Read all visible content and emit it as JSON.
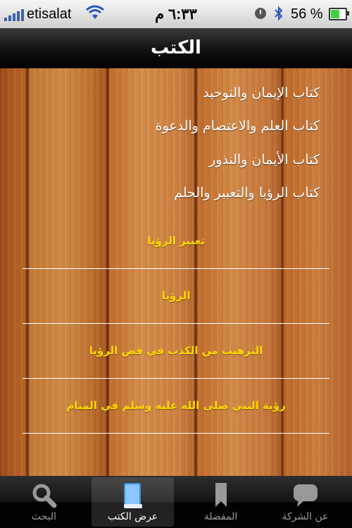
{
  "status_bar": {
    "carrier": "etisalat",
    "time": "٦:٣٣ م",
    "battery_percent": "56 %",
    "battery_level": 0.56
  },
  "nav": {
    "title": "الكتب"
  },
  "books": [
    "كتاب الإيمان والتوحيد",
    "كتاب العلم والاعتصام والدعوة",
    "كتاب الأيمان والنذور",
    "كتاب الرؤيا والتعبير والحلم"
  ],
  "sections": [
    "تعبير الرؤيا",
    "الرؤيا",
    "الترهيب من الكذب في قص الرؤيا",
    "رؤية النبي صلى الله عليه وسلم في المنام"
  ],
  "tabs": [
    {
      "label": "البحث",
      "icon": "search-icon"
    },
    {
      "label": "عرض الكتب",
      "icon": "book-icon"
    },
    {
      "label": "المفضلة",
      "icon": "bookmark-icon"
    },
    {
      "label": "عن الشركة",
      "icon": "speech-bubble-icon"
    }
  ],
  "colors": {
    "section_text": "#ffd800",
    "battery_fill": "#3fd03f"
  }
}
